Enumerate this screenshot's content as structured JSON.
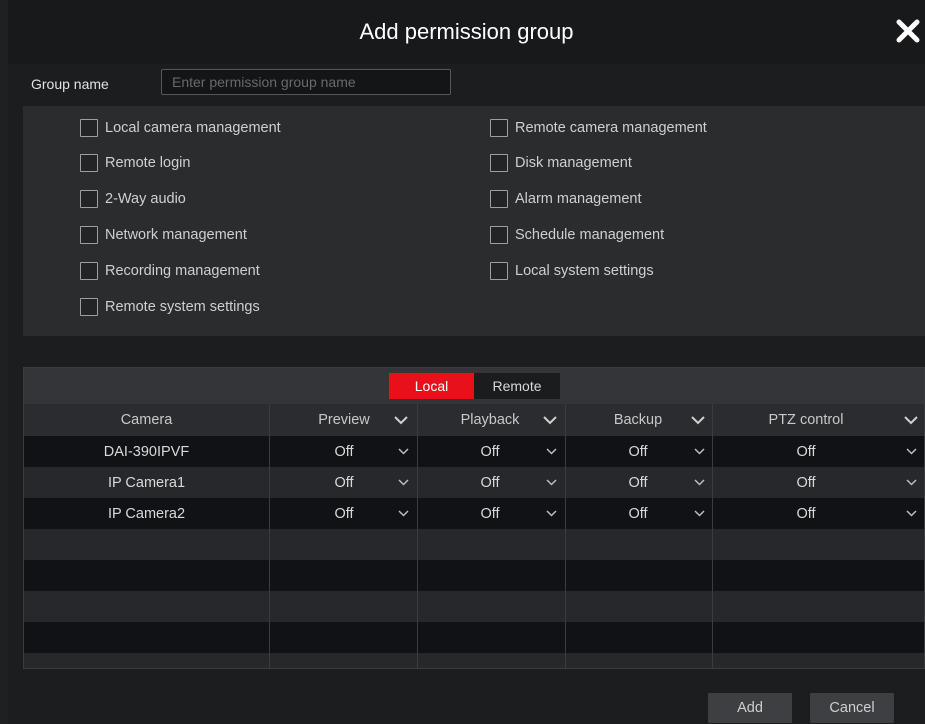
{
  "dialog": {
    "title": "Add permission group",
    "close_icon": "close-icon"
  },
  "group": {
    "label": "Group name",
    "value": "",
    "placeholder": "Enter permission group name"
  },
  "permissions": {
    "left": [
      {
        "label": "Local camera management",
        "checked": false
      },
      {
        "label": "Remote login",
        "checked": false
      },
      {
        "label": "2-Way audio",
        "checked": false
      },
      {
        "label": "Network management",
        "checked": false
      },
      {
        "label": "Recording management",
        "checked": false
      },
      {
        "label": "Remote system settings",
        "checked": false
      }
    ],
    "right": [
      {
        "label": "Remote camera management",
        "checked": false
      },
      {
        "label": "Disk management",
        "checked": false
      },
      {
        "label": "Alarm management",
        "checked": false
      },
      {
        "label": "Schedule management",
        "checked": false
      },
      {
        "label": "Local system settings",
        "checked": false
      }
    ]
  },
  "tabs": {
    "local": "Local",
    "remote": "Remote",
    "active": "Local",
    "active_color": "#e8101a"
  },
  "table": {
    "columns": [
      "Camera",
      "Preview",
      "Playback",
      "Backup",
      "PTZ control"
    ],
    "rows": [
      {
        "camera": "DAI-390IPVF",
        "preview": "Off",
        "playback": "Off",
        "backup": "Off",
        "ptz": "Off"
      },
      {
        "camera": "IP Camera1",
        "preview": "Off",
        "playback": "Off",
        "backup": "Off",
        "ptz": "Off"
      },
      {
        "camera": "IP Camera2",
        "preview": "Off",
        "playback": "Off",
        "backup": "Off",
        "ptz": "Off"
      }
    ],
    "header_icon": "chevron-down-icon"
  },
  "footer": {
    "add": "Add",
    "cancel": "Cancel"
  }
}
